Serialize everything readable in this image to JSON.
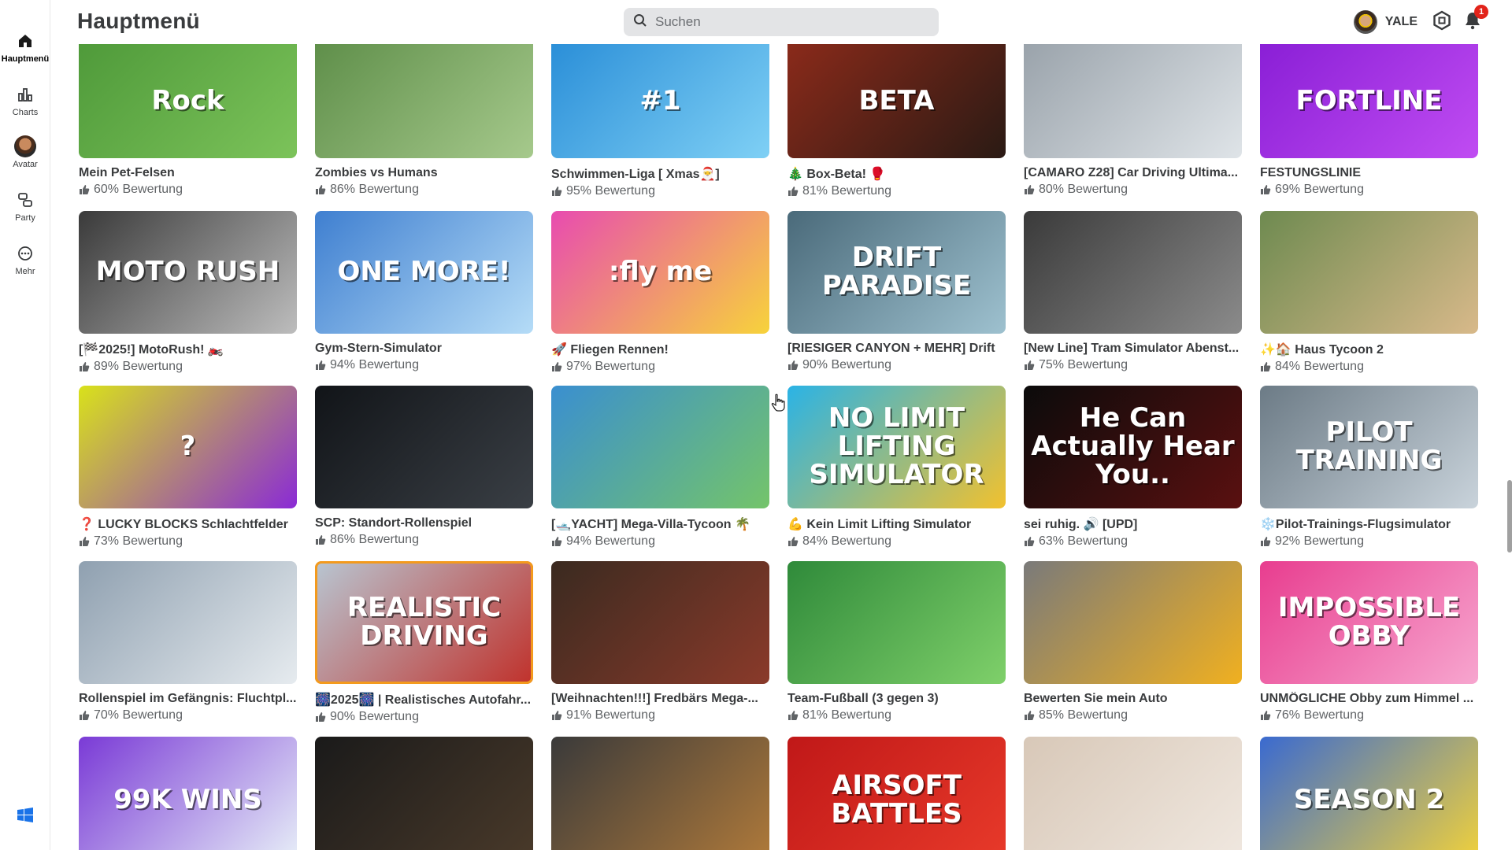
{
  "sidebar": {
    "items": [
      {
        "label": "Hauptmenü",
        "icon": "home-icon",
        "active": true
      },
      {
        "label": "Charts",
        "icon": "charts-icon",
        "active": false
      },
      {
        "label": "Avatar",
        "icon": "avatar-icon",
        "active": false
      },
      {
        "label": "Party",
        "icon": "party-icon",
        "active": false
      },
      {
        "label": "Mehr",
        "icon": "more-icon",
        "active": false
      }
    ]
  },
  "header": {
    "title": "Hauptmenü",
    "search_placeholder": "Suchen",
    "username": "YALE",
    "notification_count": "1"
  },
  "games": [
    {
      "title": "Mein Pet-Felsen",
      "rating": "60% Bewertung",
      "thumb_text": "Rock",
      "color1": "#4f9a3a",
      "color2": "#7cc35a"
    },
    {
      "title": "Zombies vs Humans",
      "rating": "86% Bewertung",
      "thumb_text": "",
      "color1": "#5f8f4a",
      "color2": "#a6c98c"
    },
    {
      "title": "Schwimmen-Liga [ Xmas🎅]",
      "rating": "95% Bewertung",
      "thumb_text": "#1",
      "color1": "#2b8fd8",
      "color2": "#7fd0f5"
    },
    {
      "title": "🎄 Box-Beta! 🥊",
      "rating": "81% Bewertung",
      "thumb_text": "BETA",
      "color1": "#8a2a1a",
      "color2": "#2a1a14"
    },
    {
      "title": "[CAMARO Z28] Car Driving Ultima...",
      "rating": "80% Bewertung",
      "thumb_text": "",
      "color1": "#9aa3ab",
      "color2": "#dfe4e8"
    },
    {
      "title": "FESTUNGSLINIE",
      "rating": "69% Bewertung",
      "thumb_text": "FORTLINE",
      "color1": "#8a1fd6",
      "color2": "#c04cf2"
    },
    {
      "title": "[🏁2025!] MotoRush! 🏍️",
      "rating": "89% Bewertung",
      "thumb_text": "MOTO RUSH",
      "color1": "#3a3a3a",
      "color2": "#bdbdbd"
    },
    {
      "title": "Gym-Stern-Simulator",
      "rating": "94% Bewertung",
      "thumb_text": "ONE MORE!",
      "color1": "#3f7fd0",
      "color2": "#b5dcf7"
    },
    {
      "title": "🚀 Fliegen Rennen!",
      "rating": "97% Bewertung",
      "thumb_text": ":fly me",
      "color1": "#e84bb0",
      "color2": "#f7d33b"
    },
    {
      "title": "[RIESIGER CANYON + MEHR] Drift",
      "rating": "90% Bewertung",
      "thumb_text": "DRIFT PARADISE",
      "color1": "#4a6a7a",
      "color2": "#9ec1cf"
    },
    {
      "title": "[New Line] Tram Simulator Abenst...",
      "rating": "75% Bewertung",
      "thumb_text": "",
      "color1": "#3a3a3a",
      "color2": "#8b8b8b"
    },
    {
      "title": "✨🏠 Haus Tycoon 2",
      "rating": "84% Bewertung",
      "thumb_text": "",
      "color1": "#6e8a50",
      "color2": "#d8b98a"
    },
    {
      "title": "❓ LUCKY BLOCKS Schlachtfelder",
      "rating": "73% Bewertung",
      "thumb_text": "?",
      "color1": "#d9e21a",
      "color2": "#8a2ad6"
    },
    {
      "title": "SCP: Standort-Rollenspiel",
      "rating": "86% Bewertung",
      "thumb_text": "",
      "color1": "#111418",
      "color2": "#3a3f45"
    },
    {
      "title": "[🛥️YACHT] Mega-Villa-Tycoon 🌴",
      "rating": "94% Bewertung",
      "thumb_text": "",
      "color1": "#3a8fd0",
      "color2": "#74c46a"
    },
    {
      "title": "💪 Kein Limit Lifting Simulator",
      "rating": "84% Bewertung",
      "thumb_text": "NO LIMIT LIFTING SIMULATOR",
      "color1": "#2ab3e6",
      "color2": "#f2c12e"
    },
    {
      "title": "sei ruhig. 🔊 [UPD]",
      "rating": "63% Bewertung",
      "thumb_text": "He Can Actually Hear You..",
      "color1": "#0b0b0b",
      "color2": "#5a1010"
    },
    {
      "title": "❄️Pilot-Trainings-Flugsimulator",
      "rating": "92% Bewertung",
      "thumb_text": "PILOT TRAINING",
      "color1": "#6c7b86",
      "color2": "#c9d3db"
    },
    {
      "title": "Rollenspiel im Gefängnis: Fluchtpl...",
      "rating": "70% Bewertung",
      "thumb_text": "",
      "color1": "#8fa0b0",
      "color2": "#e6ebef"
    },
    {
      "title": "🎆2025🎆 | Realistisches Autofahr...",
      "rating": "90% Bewertung",
      "thumb_text": "REALISTIC DRIVING",
      "color1": "#b8c6d2",
      "color2": "#c0312b"
    },
    {
      "title": "[Weihnachten!!!] Fredbärs Mega-...",
      "rating": "91% Bewertung",
      "thumb_text": "",
      "color1": "#3a2a20",
      "color2": "#8a3a2a"
    },
    {
      "title": "Team-Fußball (3 gegen 3)",
      "rating": "81% Bewertung",
      "thumb_text": "",
      "color1": "#2f8a3a",
      "color2": "#7fd06a"
    },
    {
      "title": "Bewerten Sie mein Auto",
      "rating": "85% Bewertung",
      "thumb_text": "",
      "color1": "#7a7a7a",
      "color2": "#f0b020"
    },
    {
      "title": "UNMÖGLICHE Obby zum Himmel ...",
      "rating": "76% Bewertung",
      "thumb_text": "IMPOSSIBLE OBBY",
      "color1": "#e83d8f",
      "color2": "#f7a6cf"
    },
    {
      "title": "",
      "rating": "",
      "thumb_text": "99K WINS",
      "color1": "#7a3ad6",
      "color2": "#e8f0f8"
    },
    {
      "title": "",
      "rating": "",
      "thumb_text": "",
      "color1": "#1a1a1a",
      "color2": "#4a3a2a"
    },
    {
      "title": "",
      "rating": "",
      "thumb_text": "",
      "color1": "#3a3a3a",
      "color2": "#b07a3a"
    },
    {
      "title": "",
      "rating": "",
      "thumb_text": "AIRSOFT BATTLES",
      "color1": "#c01818",
      "color2": "#e83a2a"
    },
    {
      "title": "",
      "rating": "",
      "thumb_text": "",
      "color1": "#d8c8b8",
      "color2": "#f0e8e0"
    },
    {
      "title": "",
      "rating": "",
      "thumb_text": "SEASON 2",
      "color1": "#3a6ad0",
      "color2": "#f2d23a"
    }
  ],
  "colors": {
    "accent_highlight": "#f39a1d",
    "notification_badge": "#e2231a"
  }
}
